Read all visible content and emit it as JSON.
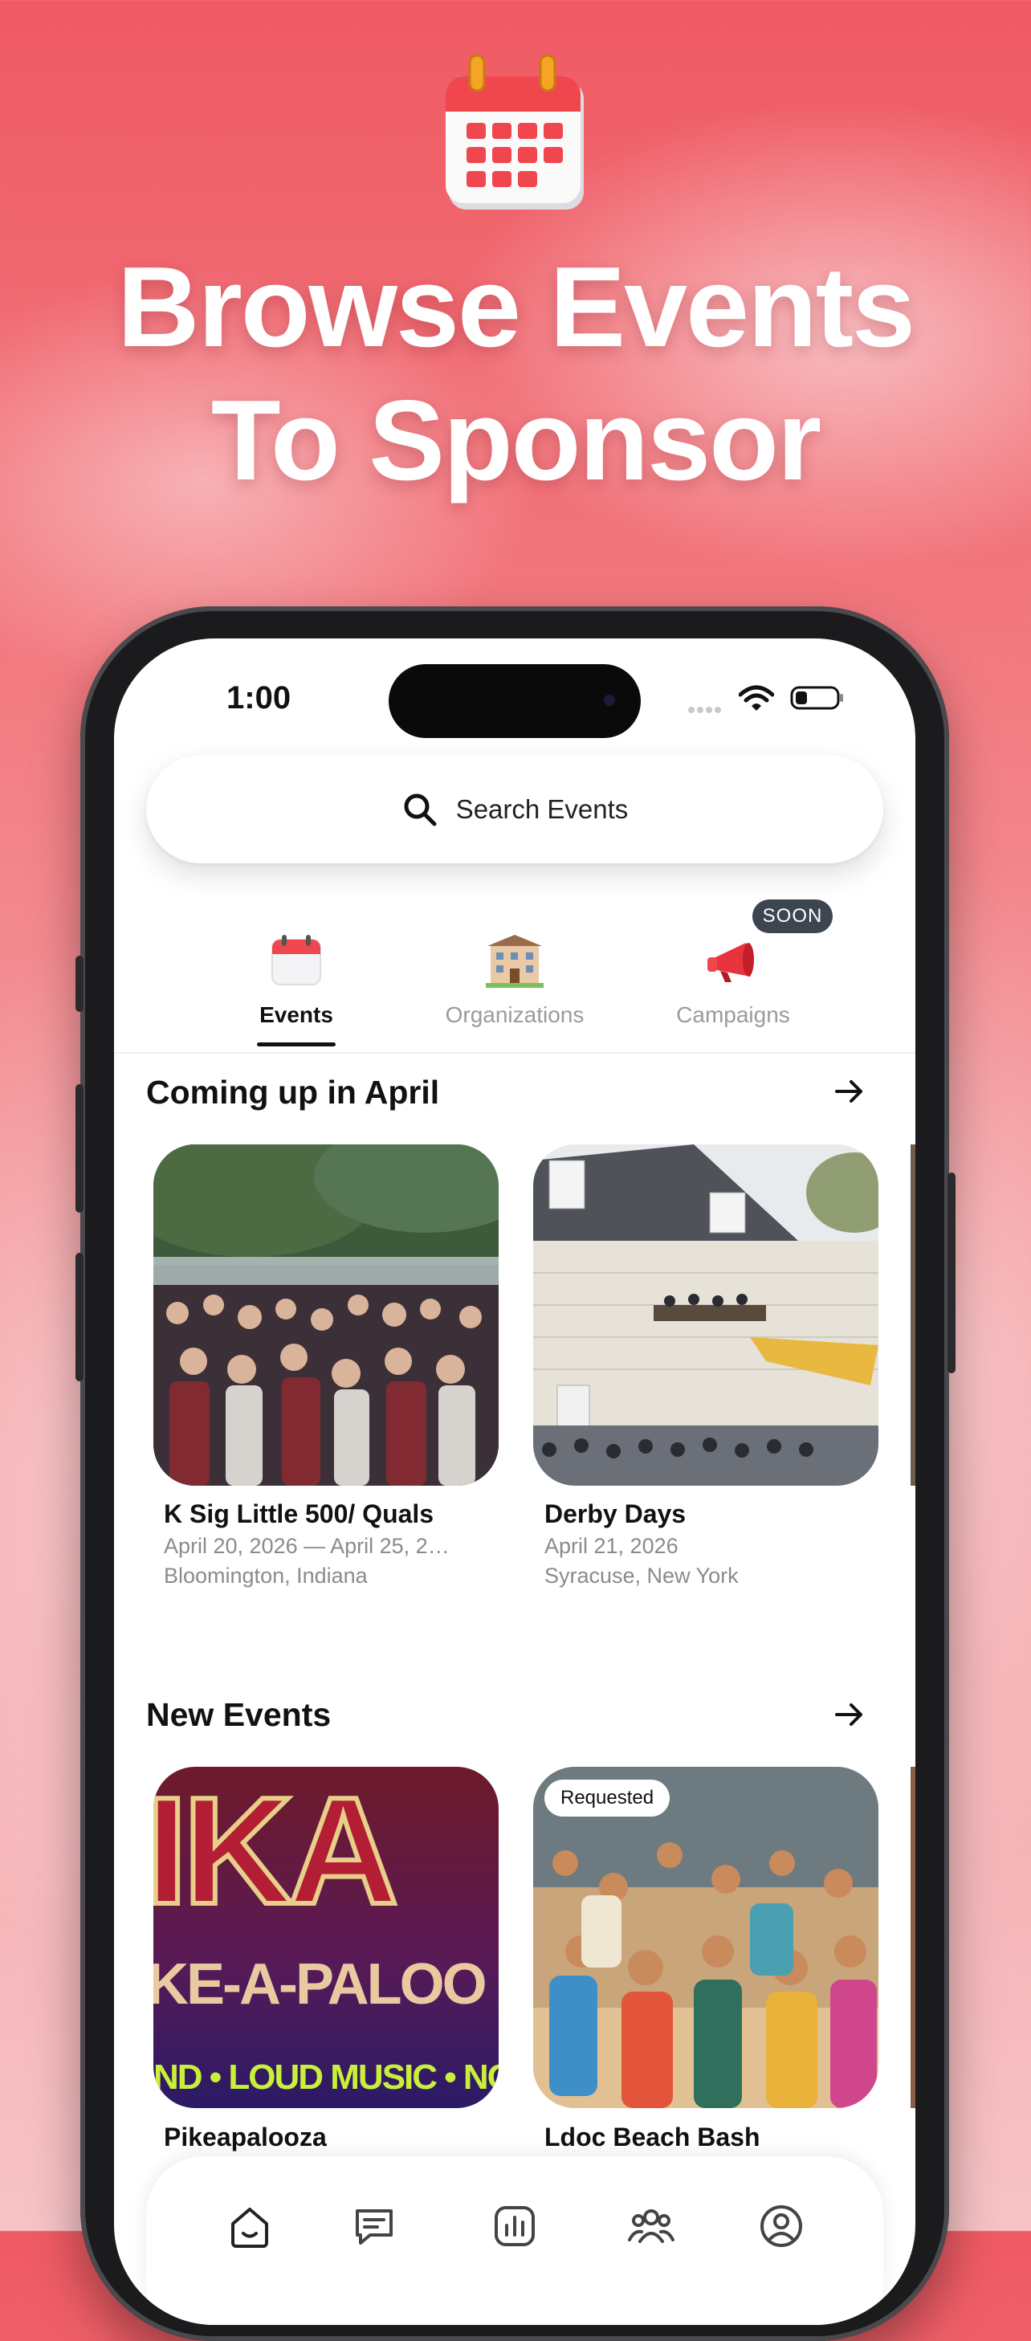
{
  "hero": {
    "title_line1": "Browse Events",
    "title_line2": "To Sponsor",
    "icon": "calendar-icon"
  },
  "status_bar": {
    "time": "1:00",
    "icons": [
      "wifi-icon",
      "battery-icon"
    ]
  },
  "search": {
    "placeholder": "Search Events",
    "icon": "search-icon"
  },
  "tabs": [
    {
      "label": "Events",
      "icon": "calendar-icon",
      "active": true
    },
    {
      "label": "Organizations",
      "icon": "building-icon",
      "active": false
    },
    {
      "label": "Campaigns",
      "icon": "megaphone-icon",
      "active": false,
      "badge": "SOON"
    }
  ],
  "sections": {
    "coming_up": {
      "title": "Coming up in April",
      "cards": [
        {
          "title": "K Sig Little 500/ Quals",
          "date": "April 20, 2026 — April 25, 2…",
          "location": "Bloomington, Indiana"
        },
        {
          "title": "Derby Days",
          "date": "April 21, 2026",
          "location": "Syracuse, New York"
        }
      ]
    },
    "new_events": {
      "title": "New Events",
      "cards": [
        {
          "title": "Pikeapalooza",
          "poster_big": "IKA",
          "poster_mid": "KE-A-PALOO",
          "poster_small": "ND • LOUD MUSIC • NO F"
        },
        {
          "title": "Ldoc Beach Bash",
          "badge": "Requested"
        }
      ]
    }
  },
  "colors": {
    "background_top": "#ef5a63",
    "background_bottom": "#f7c3c6",
    "active_tab": "#111111",
    "inactive_tab": "#9a9aa0",
    "soon_badge": "#3d4550"
  },
  "bottom_nav": [
    "home-icon",
    "messages-icon",
    "analytics-icon",
    "people-icon",
    "profile-icon"
  ]
}
